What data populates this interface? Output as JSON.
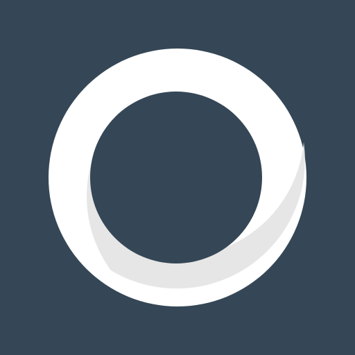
{
  "icon": {
    "name": "ring-logo-icon",
    "shape": "ring",
    "background_color": "#354756",
    "ring_color": "#ffffff",
    "shadow_color": "#e6e6e6"
  }
}
